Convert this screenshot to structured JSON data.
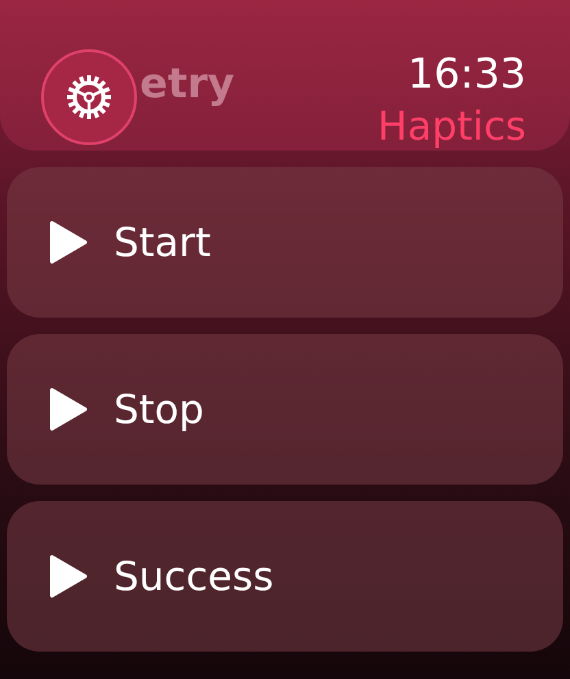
{
  "time": "16:33",
  "title": "Haptics",
  "scrolled_item": {
    "label": "etry"
  },
  "actions": [
    {
      "label": "Start"
    },
    {
      "label": "Stop"
    },
    {
      "label": "Success"
    }
  ]
}
